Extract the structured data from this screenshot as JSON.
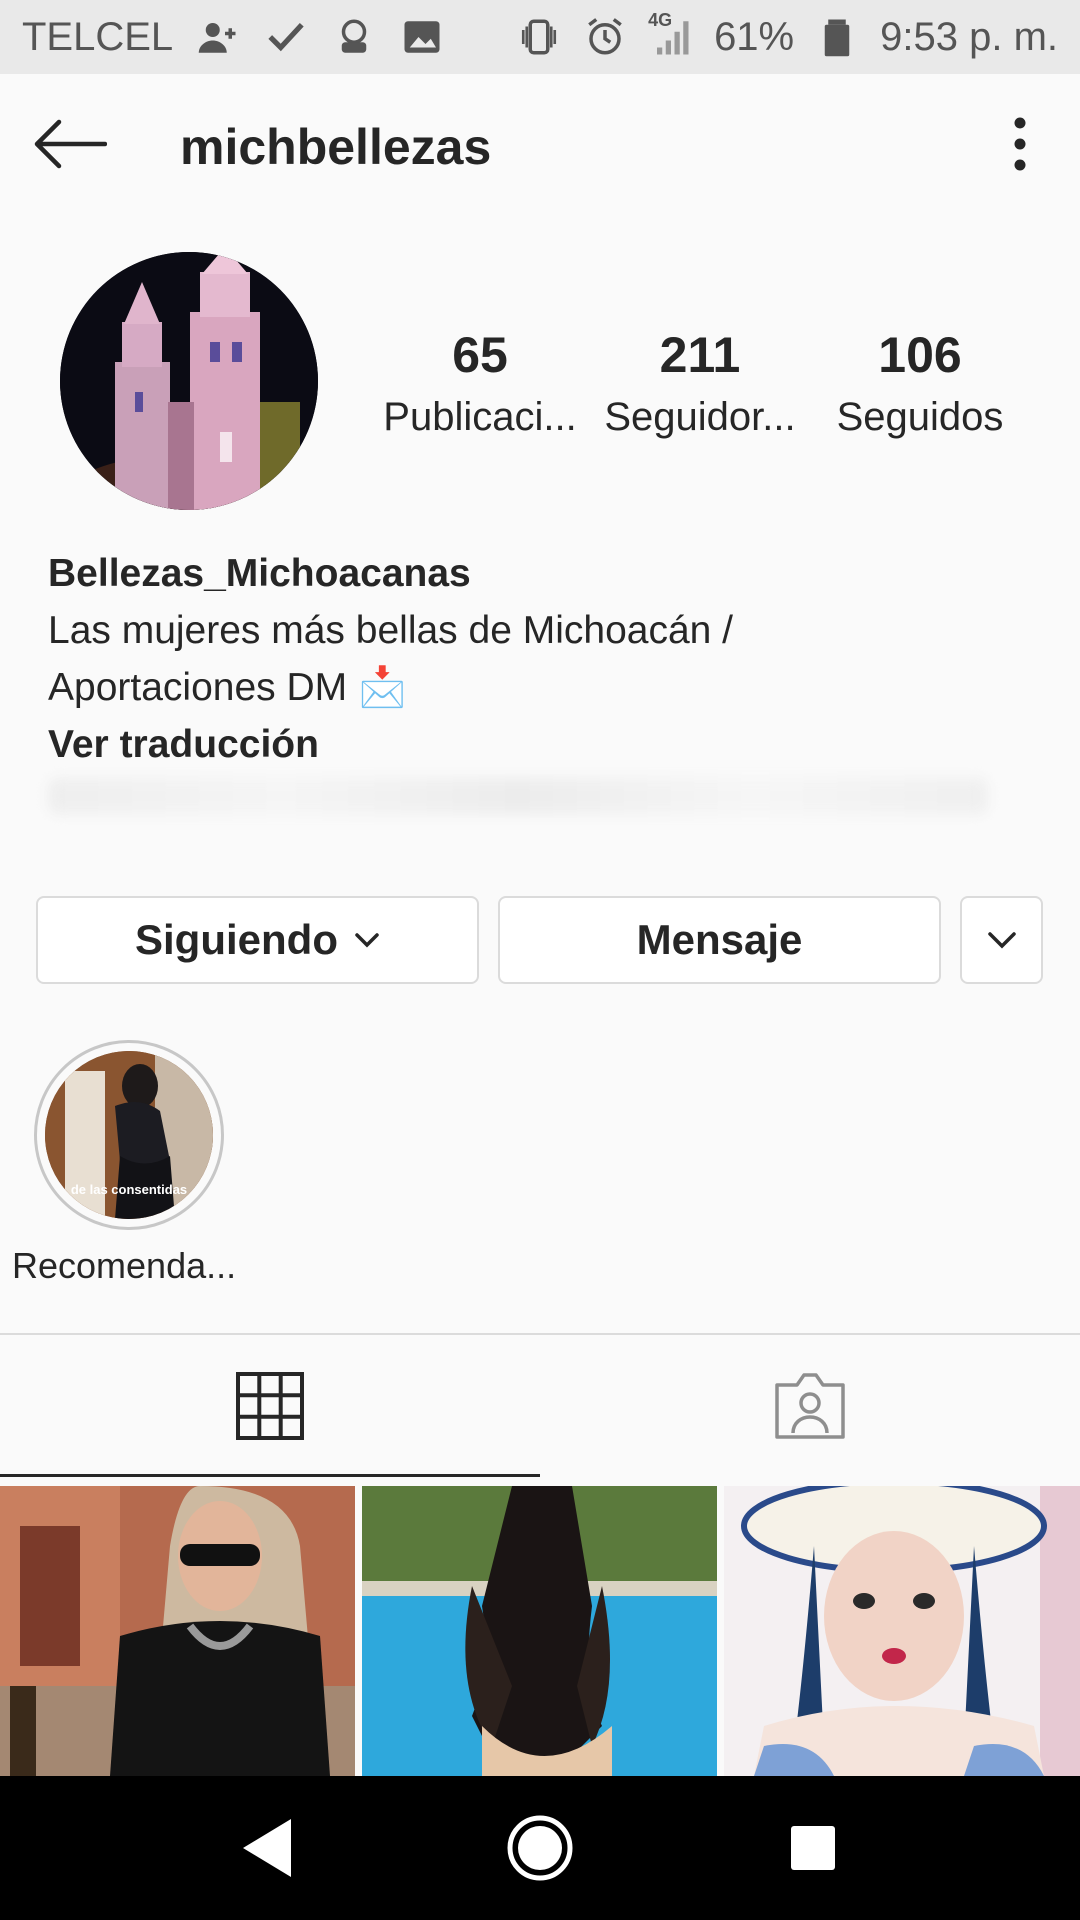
{
  "status_bar": {
    "carrier": "TELCEL",
    "network": "4G",
    "battery": "61%",
    "time": "9:53 p. m."
  },
  "header": {
    "username": "michbellezas"
  },
  "profile": {
    "stats": [
      {
        "value": "65",
        "label": "Publicaci..."
      },
      {
        "value": "211",
        "label": "Seguidor..."
      },
      {
        "value": "106",
        "label": "Seguidos"
      }
    ],
    "display_name": "Bellezas_Michoacanas",
    "bio_line1": "Las mujeres más bellas de Michoacán /",
    "bio_line2": "Aportaciones DM 📩",
    "translate_link": "Ver traducción"
  },
  "actions": {
    "following_label": "Siguiendo",
    "message_label": "Mensaje"
  },
  "highlights": [
    {
      "label": "Recomenda...",
      "overlay_text": "de las consentidas"
    }
  ],
  "tabs": [
    {
      "name": "grid",
      "icon": "grid-icon",
      "active": true
    },
    {
      "name": "tagged",
      "icon": "tagged-person-icon",
      "active": false
    }
  ],
  "colors": {
    "text": "#262626",
    "border": "#dbdbdb",
    "background": "#fafafa"
  }
}
